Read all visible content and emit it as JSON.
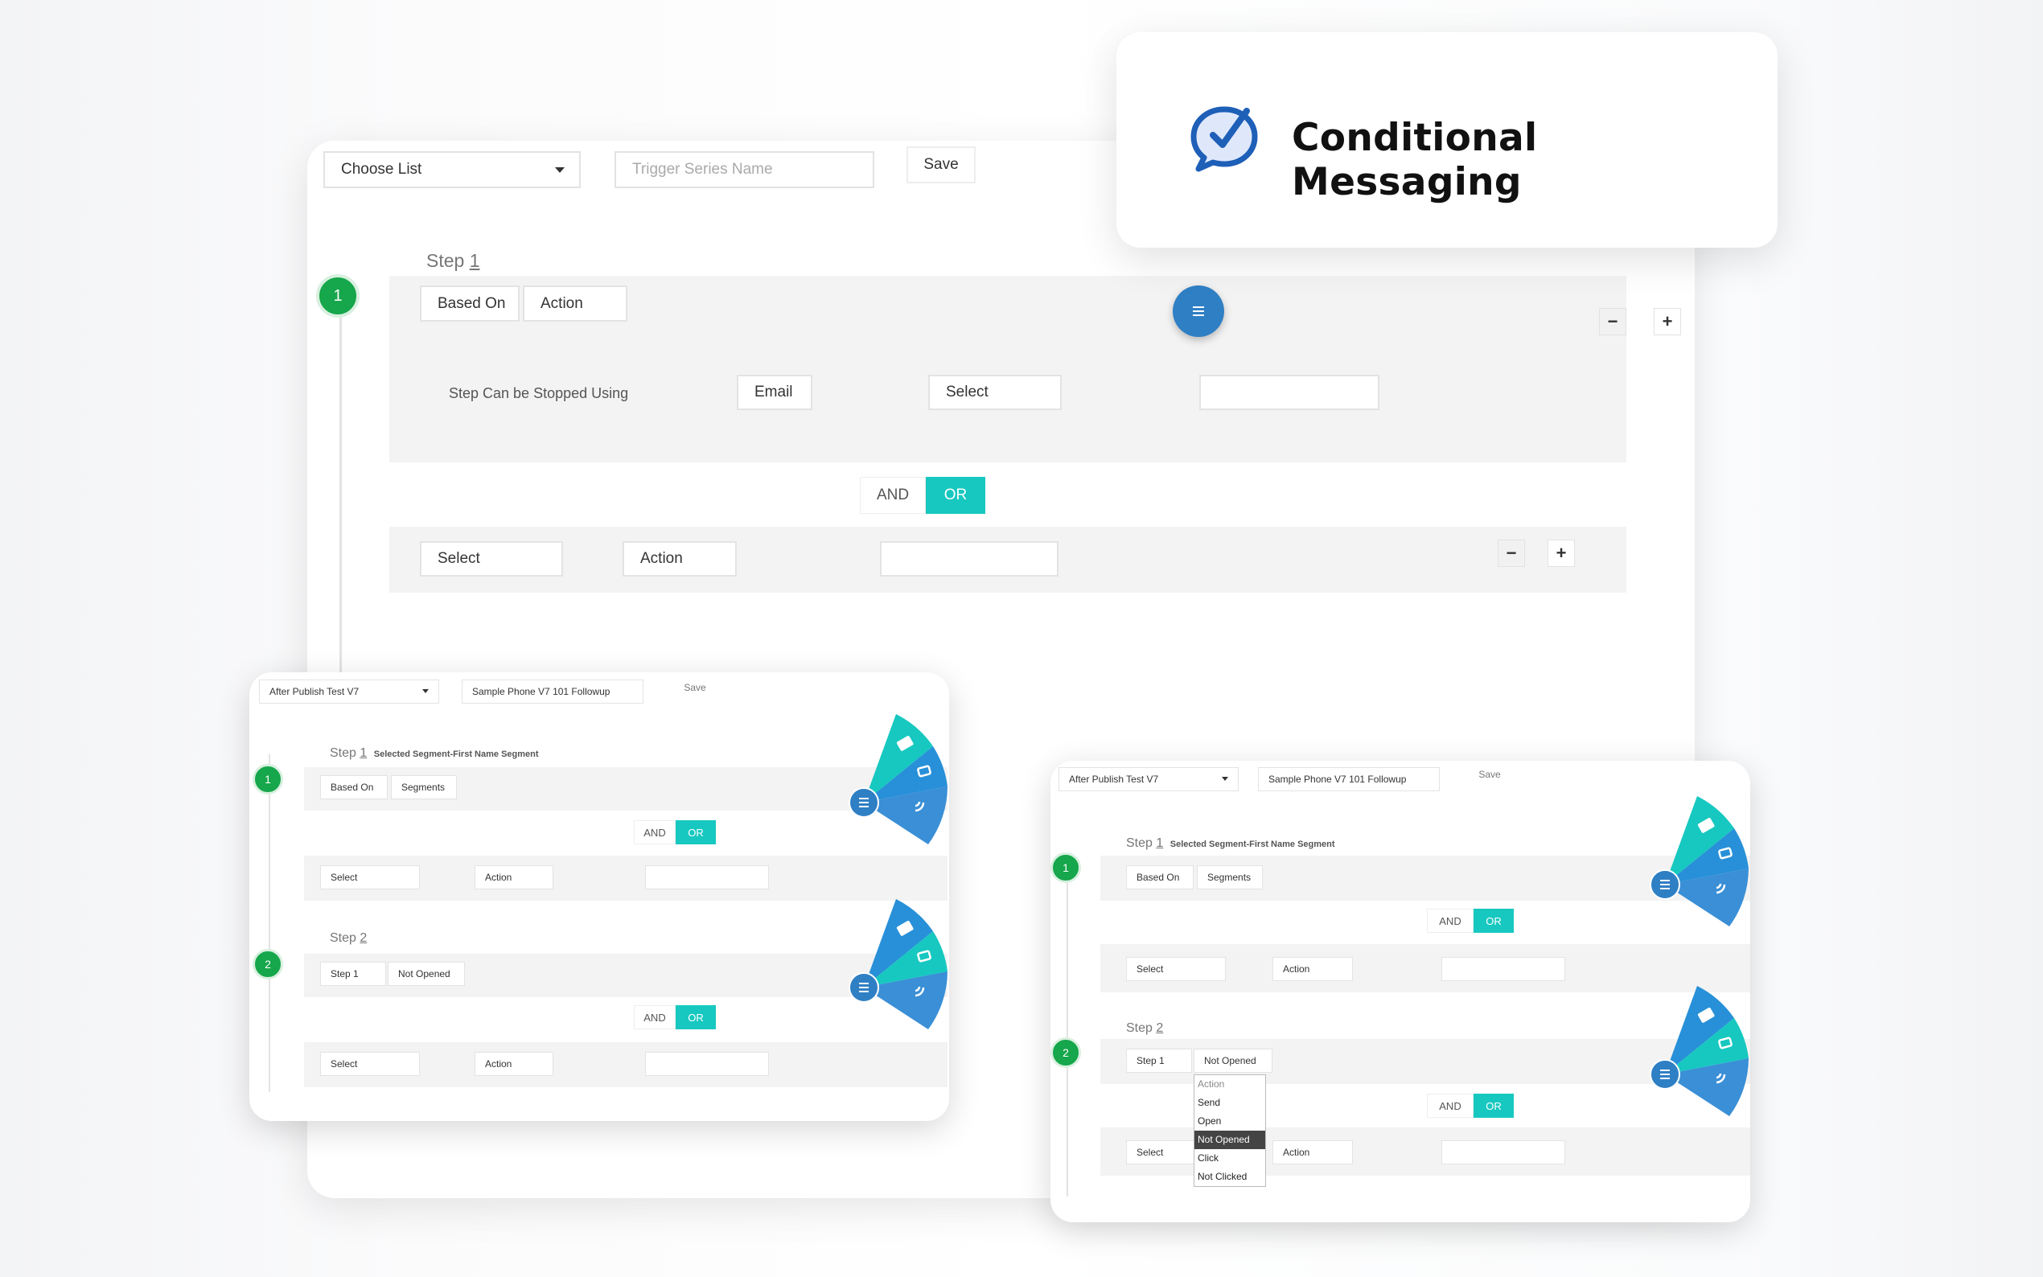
{
  "title_card": {
    "title": "Conditional Messaging",
    "icon": "chat-check-icon"
  },
  "main": {
    "choose_list": "Choose List",
    "trigger_placeholder": "Trigger Series Name",
    "save": "Save",
    "step_prefix": "Step",
    "step_num": "1",
    "step_badge": "1",
    "based_on": "Based On",
    "action": "Action",
    "stopped_label": "Step Can be Stopped Using",
    "email": "Email",
    "select": "Select",
    "and": "AND",
    "or": "OR",
    "row_select": "Select",
    "row_action": "Action",
    "minus": "−",
    "plus": "+"
  },
  "left_card": {
    "list": "After Publish Test V7",
    "series": "Sample Phone V7 101 Followup",
    "save": "Save",
    "step1_prefix": "Step",
    "step1_num": "1",
    "segment_text": "Selected Segment-First Name Segment",
    "badge1": "1",
    "based_on": "Based On",
    "segments": "Segments",
    "and": "AND",
    "or": "OR",
    "select": "Select",
    "action": "Action",
    "step2_prefix": "Step",
    "step2_num": "2",
    "badge2": "2",
    "step1_ref": "Step 1",
    "not_opened": "Not Opened"
  },
  "right_card": {
    "list": "After Publish Test V7",
    "series": "Sample Phone V7 101 Followup",
    "save": "Save",
    "step1_prefix": "Step",
    "step1_num": "1",
    "segment_text": "Selected Segment-First Name Segment",
    "badge1": "1",
    "based_on": "Based On",
    "segments": "Segments",
    "and": "AND",
    "or": "OR",
    "select": "Select",
    "action": "Action",
    "step2_prefix": "Step",
    "step2_num": "2",
    "badge2": "2",
    "step1_ref": "Step 1",
    "not_opened": "Not Opened",
    "dropdown": [
      "Action",
      "Send",
      "Open",
      "Not Opened",
      "Click",
      "Not Clicked"
    ],
    "dropdown_selected": "Not Opened"
  },
  "colors": {
    "accent_teal": "#17c8c0",
    "green": "#16a64b",
    "blue": "#2f7fc4"
  }
}
